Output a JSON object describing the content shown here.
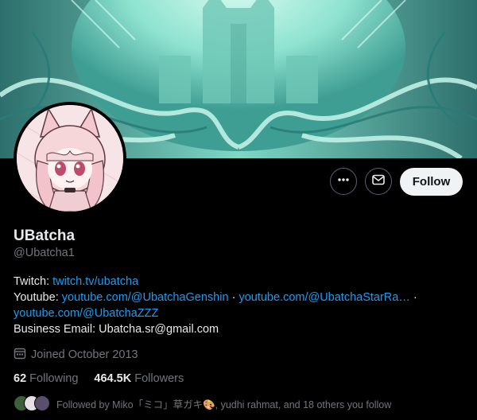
{
  "profile": {
    "name": "UBatcha",
    "handle": "@Ubatcha1",
    "follow_label": "Follow",
    "bio": {
      "twitch_label": "Twitch: ",
      "twitch_link": "twitch.tv/ubatcha",
      "youtube_label": "Youtube: ",
      "youtube_link_1": "youtube.com/@UbatchaGenshin",
      "sep_1": " · ",
      "youtube_link_2": "youtube.com/@UbatchaStarRa…",
      "sep_2": " ·",
      "youtube_link_3": "youtube.com/@UbatchaZZZ",
      "email": "Business Email: Ubatcha.sr@gmail.com"
    },
    "joined": "Joined October 2013",
    "following_count": "62",
    "following_label": "Following",
    "followers_count": "464.5K",
    "followers_label": "Followers",
    "followed_by": "Followed by Miko「ミコ」草ガキ🎨, yudhi rahmat, and 18 others you follow"
  },
  "icons": {
    "more": "more-dots-icon",
    "message": "envelope-icon",
    "calendar": "calendar-icon"
  },
  "colors": {
    "link": "#1d9bf0",
    "muted": "#71767b",
    "text": "#e7e9ea",
    "follow_bg": "#eff3f4",
    "banner_teal": "#8fe3d0"
  }
}
